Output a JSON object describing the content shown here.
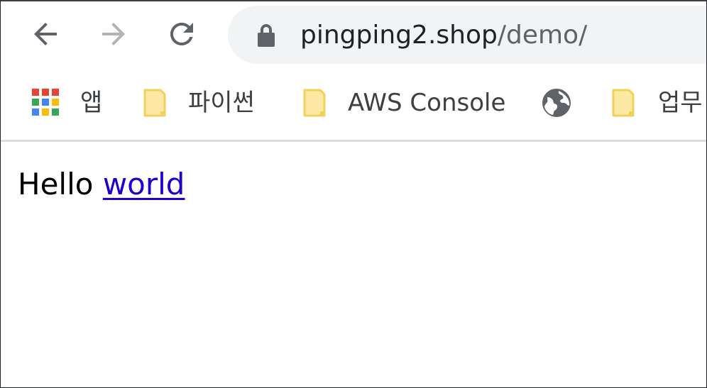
{
  "browser": {
    "url_host": "pingping2.shop",
    "url_path": "/demo/",
    "nav": {
      "back_icon": "arrow-back-icon",
      "forward_icon": "arrow-forward-icon",
      "reload_icon": "reload-icon",
      "lock_icon": "lock-icon"
    },
    "bookmarks": [
      {
        "label": "앱",
        "icon": "apps-grid-icon"
      },
      {
        "label": "파이썬",
        "icon": "folder-icon"
      },
      {
        "label": "AWS Console",
        "icon": "folder-icon"
      },
      {
        "label": "",
        "icon": "globe-icon"
      },
      {
        "label": "업무",
        "icon": "folder-icon"
      }
    ],
    "colors": {
      "omnibox_bg": "#f1f3f4",
      "folder_fill": "#fbe9a4",
      "folder_stroke": "#f3cf5b",
      "link": "#2200cc"
    }
  },
  "page": {
    "text": "Hello",
    "link_text": "world"
  }
}
